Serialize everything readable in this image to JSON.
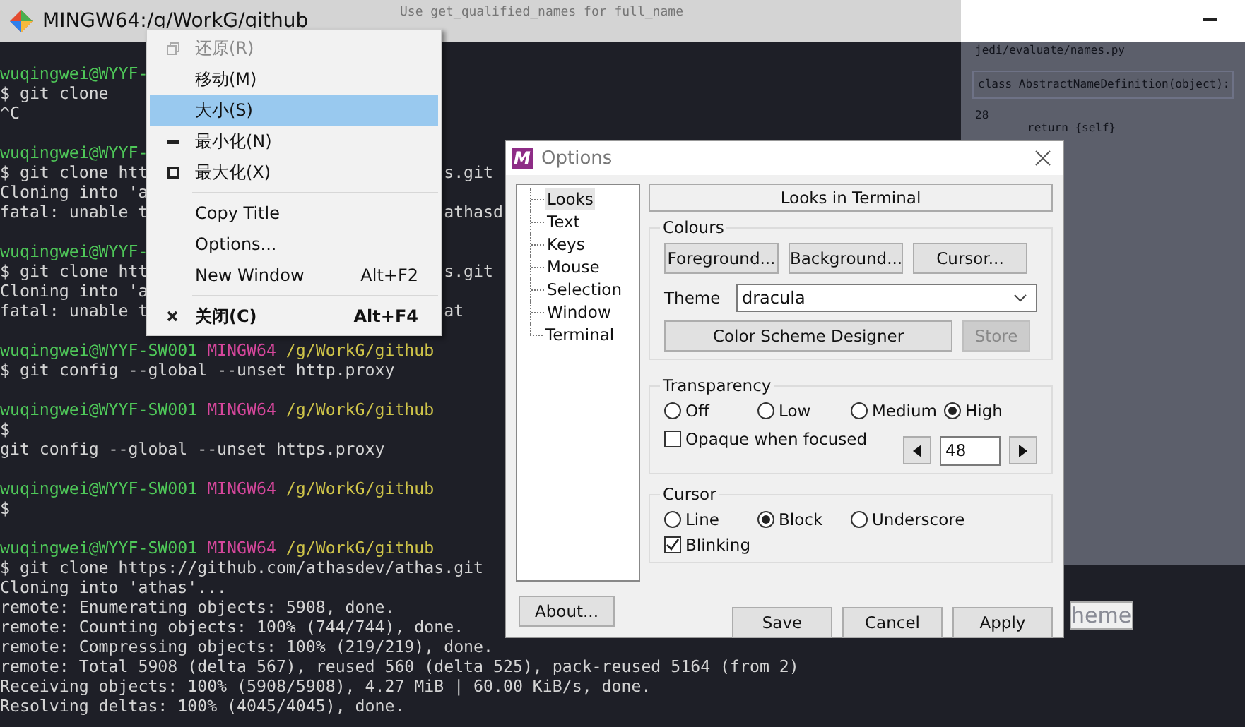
{
  "title_bar": {
    "title": "MINGW64:/g/WorkG/github"
  },
  "background_texts": [
    {
      "kind": "hint",
      "text": "Use get_qualified_names for full_name"
    },
    {
      "kind": "code",
      "text": "jedi/evaluate/names.py"
    },
    {
      "kind": "code",
      "text": "class AbstractNameDefinition(object):"
    },
    {
      "kind": "code",
      "text": "28"
    },
    {
      "kind": "code",
      "text": "return {self}"
    },
    {
      "kind": "heading",
      "text": "heme"
    }
  ],
  "terminal": {
    "lines": [
      {
        "kind": "prompt",
        "user": "wuqingwei@WYYF-"
      },
      {
        "kind": "text",
        "text": "$ git clone"
      },
      {
        "kind": "text",
        "text": "^C"
      },
      {
        "kind": "blank"
      },
      {
        "kind": "prompt",
        "user": "wuqingwei@WYYF-"
      },
      {
        "kind": "text",
        "text": "$ git clone htt",
        "after_overlay": "s.git"
      },
      {
        "kind": "text",
        "text": "Cloning into 'a"
      },
      {
        "kind": "text",
        "text": "fatal: unable t",
        "after_overlay": "athasd"
      },
      {
        "kind": "blank"
      },
      {
        "kind": "prompt",
        "user": "wuqingwei@WYYF-"
      },
      {
        "kind": "text",
        "text": "$ git clone htt",
        "after_overlay": "s.git"
      },
      {
        "kind": "text",
        "text": "Cloning into 'a"
      },
      {
        "kind": "text",
        "text": "fatal: unable t",
        "after_overlay": "at"
      },
      {
        "kind": "blank"
      },
      {
        "kind": "prompt",
        "user": "wuqingwei@WYYF-SW001",
        "shell": "MINGW64",
        "path": "/g/WorkG/github"
      },
      {
        "kind": "text",
        "text": "$ git config --global --unset http.proxy"
      },
      {
        "kind": "blank"
      },
      {
        "kind": "prompt",
        "user": "wuqingwei@WYYF-SW001",
        "shell": "MINGW64",
        "path": "/g/WorkG/github"
      },
      {
        "kind": "text",
        "text": "$"
      },
      {
        "kind": "text",
        "text": "git config --global --unset https.proxy"
      },
      {
        "kind": "blank"
      },
      {
        "kind": "prompt",
        "user": "wuqingwei@WYYF-SW001",
        "shell": "MINGW64",
        "path": "/g/WorkG/github"
      },
      {
        "kind": "text",
        "text": "$"
      },
      {
        "kind": "blank"
      },
      {
        "kind": "prompt",
        "user": "wuqingwei@WYYF-SW001",
        "shell": "MINGW64",
        "path": "/g/WorkG/github"
      },
      {
        "kind": "text",
        "text": "$ git clone https://github.com/athasdev/athas.git"
      },
      {
        "kind": "text",
        "text": "Cloning into 'athas'..."
      },
      {
        "kind": "text",
        "text": "remote: Enumerating objects: 5908, done."
      },
      {
        "kind": "text",
        "text": "remote: Counting objects: 100% (744/744), done."
      },
      {
        "kind": "text",
        "text": "remote: Compressing objects: 100% (219/219), done."
      },
      {
        "kind": "text",
        "text": "remote: Total 5908 (delta 567), reused 560 (delta 525), pack-reused 5164 (from 2)"
      },
      {
        "kind": "text",
        "text": "Receiving objects: 100% (5908/5908), 4.27 MiB | 60.00 KiB/s, done."
      },
      {
        "kind": "text",
        "text": "Resolving deltas: 100% (4045/4045), done."
      }
    ]
  },
  "context_menu": {
    "items": [
      {
        "kind": "item",
        "label": "还原(R)",
        "disabled": true,
        "selected": false,
        "default": false
      },
      {
        "kind": "item",
        "label": "移动(M)",
        "disabled": false,
        "selected": false,
        "default": false
      },
      {
        "kind": "item",
        "label": "大小(S)",
        "disabled": false,
        "selected": true,
        "default": false
      },
      {
        "kind": "item",
        "label": "最小化(N)",
        "disabled": false,
        "selected": false,
        "default": false
      },
      {
        "kind": "item",
        "label": "最大化(X)",
        "disabled": false,
        "selected": false,
        "default": false
      },
      {
        "kind": "separator"
      },
      {
        "kind": "item",
        "label": "Copy Title",
        "disabled": false,
        "selected": false,
        "default": false
      },
      {
        "kind": "item",
        "label": "Options...",
        "disabled": false,
        "selected": false,
        "default": false
      },
      {
        "kind": "item",
        "label": "New Window",
        "shortcut": "Alt+F2",
        "disabled": false,
        "selected": false,
        "default": false
      },
      {
        "kind": "separator"
      },
      {
        "kind": "item",
        "label": "关闭(C)",
        "shortcut": "Alt+F4",
        "disabled": false,
        "selected": false,
        "default": true
      }
    ]
  },
  "dialog": {
    "title": "Options",
    "icon_letter": "M",
    "tree": [
      {
        "label": "Looks",
        "selected": true
      },
      {
        "label": "Text",
        "selected": false
      },
      {
        "label": "Keys",
        "selected": false
      },
      {
        "label": "Mouse",
        "selected": false
      },
      {
        "label": "Selection",
        "selected": false
      },
      {
        "label": "Window",
        "selected": false
      },
      {
        "label": "Terminal",
        "selected": false
      }
    ],
    "heading": "Looks in Terminal",
    "colours": {
      "title": "Colours",
      "buttons": [
        "Foreground...",
        "Background...",
        "Cursor..."
      ],
      "theme_label": "Theme",
      "theme_value": "dracula",
      "designer_button": "Color Scheme Designer",
      "store_button": {
        "label": "Store",
        "disabled": true
      }
    },
    "transparency": {
      "title": "Transparency",
      "options": [
        {
          "label": "Off",
          "selected": false
        },
        {
          "label": "Low",
          "selected": false
        },
        {
          "label": "Medium",
          "selected": false
        },
        {
          "label": "High",
          "selected": true
        }
      ],
      "opaque_when_focused": {
        "label": "Opaque when focused",
        "checked": false
      },
      "value": "48"
    },
    "cursor": {
      "title": "Cursor",
      "options": [
        {
          "label": "Line",
          "selected": false
        },
        {
          "label": "Block",
          "selected": true
        },
        {
          "label": "Underscore",
          "selected": false
        }
      ],
      "blinking": {
        "label": "Blinking",
        "checked": true
      }
    },
    "buttons": {
      "about": "About...",
      "save": "Save",
      "cancel": "Cancel",
      "apply": "Apply"
    }
  }
}
